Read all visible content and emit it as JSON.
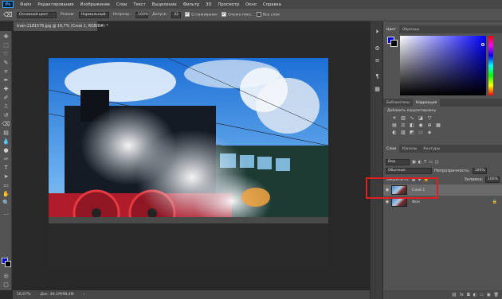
{
  "app": {
    "logo": "Ps"
  },
  "menu": [
    "Файл",
    "Редактирование",
    "Изображение",
    "Слои",
    "Текст",
    "Выделение",
    "Фильтр",
    "3D",
    "Просмотр",
    "Окно",
    "Справка"
  ],
  "options_bar": {
    "tool_icon": "eraser-icon",
    "preset": "Основной цвет",
    "mode_label": "Режим:",
    "mode_value": "Нормальный",
    "opacity_label": "Непрозр.:",
    "opacity_value": "100%",
    "tolerance_label": "Допуск:",
    "tolerance_value": "32",
    "antialias_label": "Сглаживание",
    "contiguous_label": "Смежн.пикс.",
    "all_layers_label": "Все слои"
  },
  "document": {
    "tab_title": "train-2181576.jpg @ 16,7% (Слой 1, RGB/8#) *",
    "zoom": "16,67%",
    "doc_size": "Док: 49,1M/98,4M"
  },
  "color_panel": {
    "tabs": [
      "Цвет",
      "Образцы"
    ],
    "foreground": "#0000e6",
    "background": "#000000"
  },
  "adjust_panel": {
    "tabs": [
      "Библиотеки",
      "Коррекция"
    ],
    "title": "Добавить корректировку"
  },
  "layers_panel": {
    "tabs": [
      "Слои",
      "Каналы",
      "Контуры"
    ],
    "kind_filter": "Вид",
    "blend_mode": "Обычные",
    "opacity_label": "Непрозрачность:",
    "opacity_value": "100%",
    "lock_label": "Закрепить:",
    "fill_label": "Заливка:",
    "fill_value": "100%",
    "layers": [
      {
        "name": "Слой 1",
        "selected": true,
        "locked": false
      },
      {
        "name": "Фон",
        "selected": false,
        "locked": true
      }
    ]
  },
  "colors": {
    "accent": "#31a8ff",
    "highlight": "#e02020",
    "panel_bg": "#535353",
    "workspace": "#282828"
  }
}
